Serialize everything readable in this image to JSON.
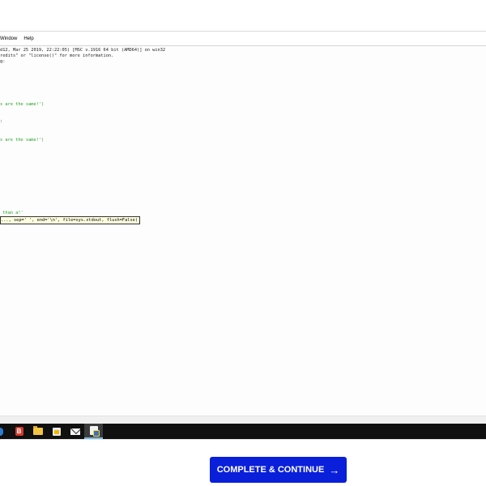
{
  "menubar": {
    "items": [
      "Window",
      "Help"
    ],
    "visible_labels": [
      "Window",
      "Help"
    ]
  },
  "shell": {
    "lines": [
      {
        "text": "d12, Mar 25 2019, 22:22:05) [MSC v.1916 64 bit (AMD64)] on win32",
        "color": "default"
      },
      {
        "text": "redits\" or \"license()\" for more information.",
        "color": "default"
      },
      {
        "text": "g:",
        "color": "default"
      },
      {
        "text": "s are the same!')",
        "color": "green"
      },
      {
        "text": ":",
        "color": "default"
      },
      {
        "text": "s are the same!')",
        "color": "green"
      },
      {
        "text": " than a!'",
        "color": "green"
      }
    ],
    "calltip": "..., sep=' ', end='\\n', file=sys.stdout, flush=False)"
  },
  "taskbar": {
    "icons": [
      "edge-icon",
      "bandizip-icon",
      "file-explorer-icon",
      "store-icon",
      "mail-icon",
      "idle-icon"
    ],
    "active": "idle-icon"
  },
  "cta": {
    "label": "COMPLETE & CONTINUE",
    "arrow": "→",
    "color": "#0a1fd9"
  }
}
